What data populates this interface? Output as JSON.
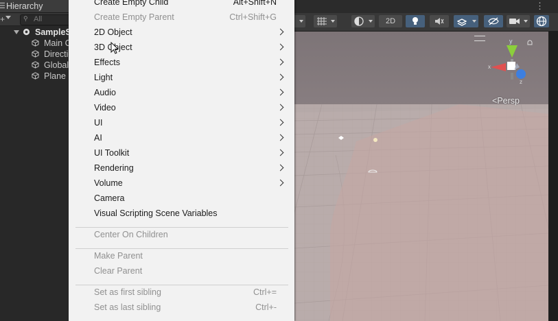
{
  "hierarchy": {
    "tab_title": "Hierarchy",
    "search_placeholder": "All",
    "items": [
      {
        "label": "SampleScene",
        "root": true
      },
      {
        "label": "Main Camera"
      },
      {
        "label": "Directional Light"
      },
      {
        "label": "Global Volume"
      },
      {
        "label": "Plane"
      }
    ]
  },
  "scene_toolbar": {
    "mode_2d_label": "2D",
    "persp_label": "Persp"
  },
  "menu": {
    "items": [
      {
        "label": "Create Empty Child",
        "shortcut": "Alt+Shift+N"
      },
      {
        "label": "Create Empty Parent",
        "shortcut": "Ctrl+Shift+G",
        "disabled": true
      },
      {
        "label": "2D Object",
        "submenu": true
      },
      {
        "label": "3D Object",
        "submenu": true
      },
      {
        "label": "Effects",
        "submenu": true
      },
      {
        "label": "Light",
        "submenu": true
      },
      {
        "label": "Audio",
        "submenu": true
      },
      {
        "label": "Video",
        "submenu": true
      },
      {
        "label": "UI",
        "submenu": true
      },
      {
        "label": "AI",
        "submenu": true
      },
      {
        "label": "UI Toolkit",
        "submenu": true
      },
      {
        "label": "Rendering",
        "submenu": true
      },
      {
        "label": "Volume",
        "submenu": true
      },
      {
        "label": "Camera"
      },
      {
        "label": "Visual Scripting Scene Variables"
      },
      {
        "separator": true
      },
      {
        "label": "Center On Children",
        "disabled": true
      },
      {
        "separator": true
      },
      {
        "label": "Make Parent",
        "disabled": true
      },
      {
        "label": "Clear Parent",
        "disabled": true
      },
      {
        "separator": true
      },
      {
        "label": "Set as first sibling",
        "shortcut": "Ctrl+=",
        "disabled": true
      },
      {
        "label": "Set as last sibling",
        "shortcut": "Ctrl+-",
        "disabled": true
      }
    ]
  },
  "colors": {
    "menu_bg": "#f2f2f2",
    "panel_bg": "#282828",
    "toolbar_active": "#46607c",
    "gizmo_x": "#e05050",
    "gizmo_y": "#8ccf3c",
    "gizmo_z": "#3d7fe0"
  }
}
